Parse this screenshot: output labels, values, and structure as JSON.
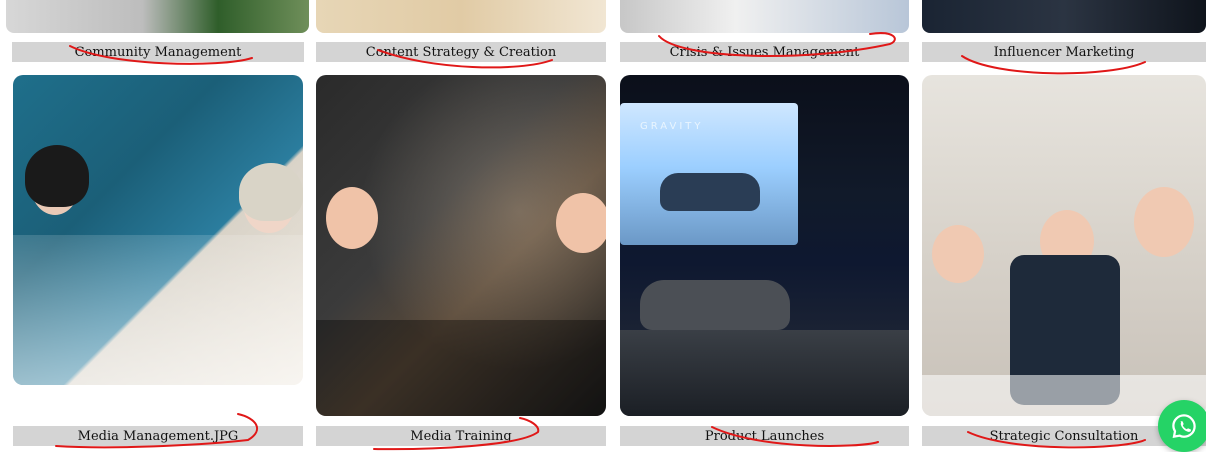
{
  "top_row": [
    {
      "label": "Community Management"
    },
    {
      "label": "Content Strategy & Creation"
    },
    {
      "label": "Crisis & Issues Management"
    },
    {
      "label": "Influencer Marketing"
    }
  ],
  "bottom_row": [
    {
      "label": "Media Management.JPG"
    },
    {
      "label": "Media Training"
    },
    {
      "label": "Product Launches"
    },
    {
      "label": "Strategic Consultation"
    }
  ],
  "screen_text": {
    "gravity_sign": "GRAVITY"
  },
  "colors": {
    "label_bar": "#d4d4d4",
    "scribble": "#e01818",
    "whatsapp": "#25d366"
  },
  "icons": {
    "whatsapp": "whatsapp-icon"
  }
}
